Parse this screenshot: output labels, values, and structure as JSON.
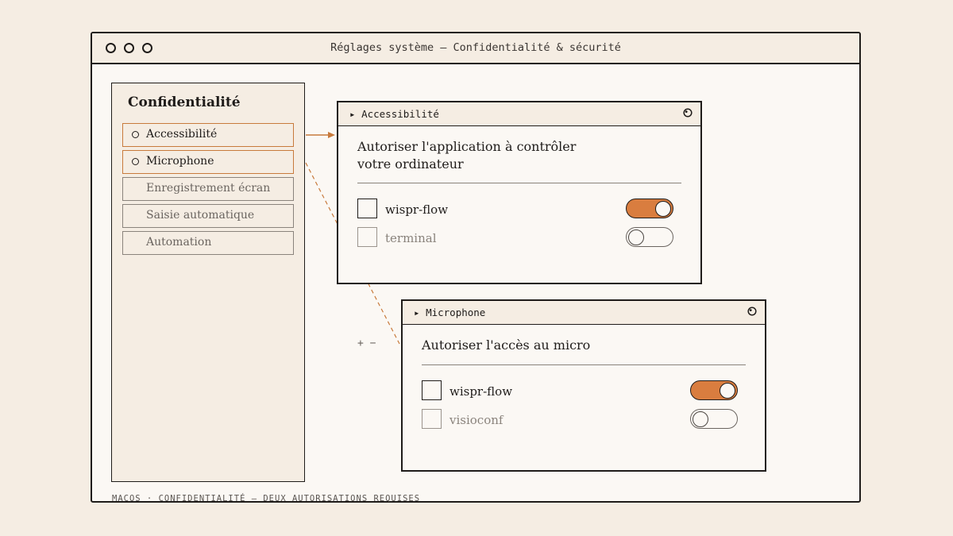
{
  "window": {
    "title": "Réglages système — Confidentialité & sécurité"
  },
  "sidebar": {
    "title": "Confidentialité",
    "items": [
      {
        "label": "Accessibilité",
        "active": true
      },
      {
        "label": "Microphone",
        "active": true
      },
      {
        "label": "Enregistrement écran",
        "active": false
      },
      {
        "label": "Saisie automatique",
        "active": false
      },
      {
        "label": "Automation",
        "active": false
      }
    ]
  },
  "panels": {
    "accessibility": {
      "header": "Accessibilité",
      "heading_line1": "Autoriser l'application à contrôler",
      "heading_line2": "votre ordinateur",
      "apps": [
        {
          "name": "wispr-flow",
          "enabled": true
        },
        {
          "name": "terminal",
          "enabled": false
        }
      ],
      "add_remove": "+ −"
    },
    "microphone": {
      "header": "Microphone",
      "heading": "Autoriser l'accès au micro",
      "apps": [
        {
          "name": "wispr-flow",
          "enabled": true
        },
        {
          "name": "visioconf",
          "enabled": false
        }
      ]
    }
  },
  "footer": "MACOS · CONFIDENTIALITÉ — DEUX AUTORISATIONS REQUISES",
  "colors": {
    "accent": "#d97d3f",
    "ink": "#1f1c1a",
    "paper": "#fbf8f4",
    "background": "#f5ede3"
  },
  "icons": {
    "panel_header": "triangle-right-icon",
    "panel_action": "refresh-icon",
    "sidebar_bullet": "circle-icon"
  }
}
